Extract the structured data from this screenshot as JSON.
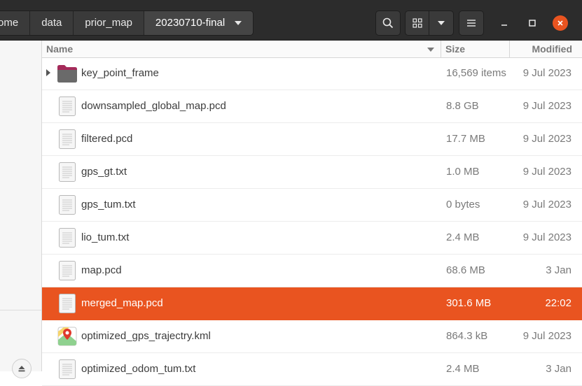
{
  "breadcrumb": [
    {
      "label": "ome"
    },
    {
      "label": "data"
    },
    {
      "label": "prior_map"
    },
    {
      "label": "20230710-final"
    }
  ],
  "columns": {
    "name": "Name",
    "size": "Size",
    "modified": "Modified"
  },
  "files": [
    {
      "name": "key_point_frame",
      "size": "16,569 items",
      "modified": "9 Jul 2023",
      "kind": "folder"
    },
    {
      "name": "downsampled_global_map.pcd",
      "size": "8.8 GB",
      "modified": "9 Jul 2023",
      "kind": "text"
    },
    {
      "name": "filtered.pcd",
      "size": "17.7 MB",
      "modified": "9 Jul 2023",
      "kind": "text"
    },
    {
      "name": "gps_gt.txt",
      "size": "1.0 MB",
      "modified": "9 Jul 2023",
      "kind": "text"
    },
    {
      "name": "gps_tum.txt",
      "size": "0 bytes",
      "modified": "9 Jul 2023",
      "kind": "text"
    },
    {
      "name": "lio_tum.txt",
      "size": "2.4 MB",
      "modified": "9 Jul 2023",
      "kind": "text"
    },
    {
      "name": "map.pcd",
      "size": "68.6 MB",
      "modified": "3 Jan",
      "kind": "text"
    },
    {
      "name": "merged_map.pcd",
      "size": "301.6 MB",
      "modified": "22:02",
      "kind": "text",
      "selected": true
    },
    {
      "name": "optimized_gps_trajectry.kml",
      "size": "864.3 kB",
      "modified": "9 Jul 2023",
      "kind": "map"
    },
    {
      "name": "optimized_odom_tum.txt",
      "size": "2.4 MB",
      "modified": "3 Jan",
      "kind": "text"
    }
  ],
  "colors": {
    "accent": "#e95420",
    "header": "#2c2c2c",
    "close": "#e95420"
  }
}
